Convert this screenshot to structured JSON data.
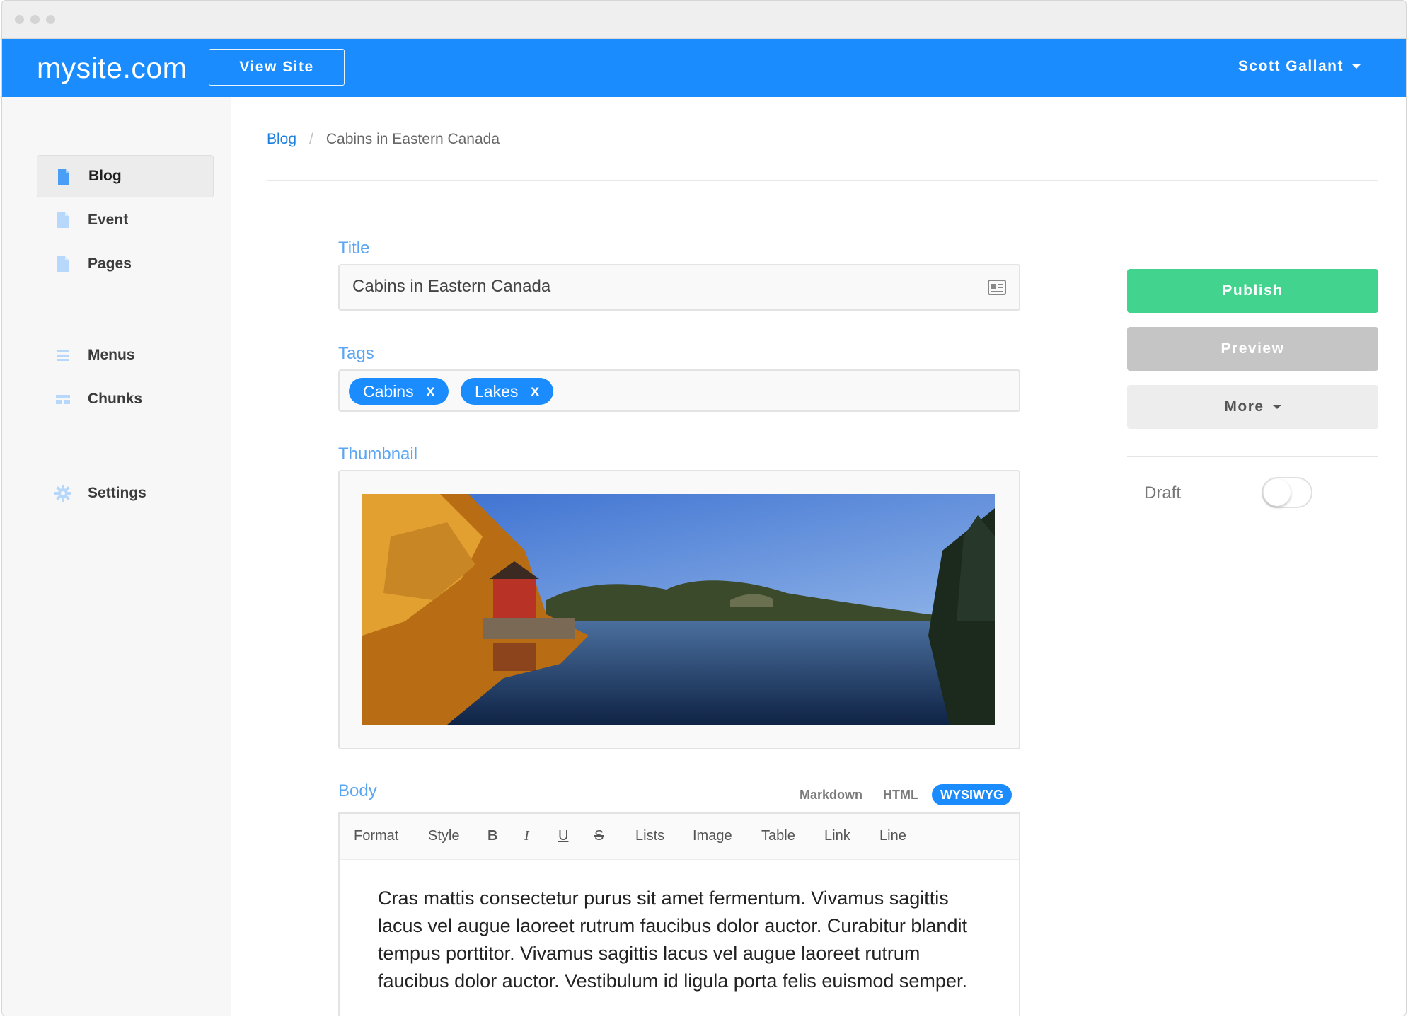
{
  "header": {
    "site_name": "mysite.com",
    "view_site_label": "View Site",
    "user_name": "Scott Gallant"
  },
  "sidebar": {
    "items": [
      {
        "label": "Blog",
        "icon": "document-icon",
        "active": true
      },
      {
        "label": "Event",
        "icon": "document-icon"
      },
      {
        "label": "Pages",
        "icon": "document-icon"
      },
      {
        "label": "Menus",
        "icon": "menu-lines-icon"
      },
      {
        "label": "Chunks",
        "icon": "chunks-icon"
      },
      {
        "label": "Settings",
        "icon": "gear-icon"
      }
    ]
  },
  "breadcrumb": {
    "parent": "Blog",
    "separator": "/",
    "current": "Cabins in Eastern Canada"
  },
  "form": {
    "title_label": "Title",
    "title_value": "Cabins in Eastern Canada",
    "tags_label": "Tags",
    "tags": [
      "Cabins",
      "Lakes"
    ],
    "tag_remove": "x",
    "thumbnail_label": "Thumbnail",
    "body_label": "Body",
    "body_modes": [
      "Markdown",
      "HTML",
      "WYSIWYG"
    ],
    "body_mode_selected": "WYSIWYG",
    "toolbar": [
      "Format",
      "Style",
      "B",
      "I",
      "U",
      "S",
      "Lists",
      "Image",
      "Table",
      "Link",
      "Line"
    ],
    "body_text": "Cras mattis consectetur purus sit amet fermentum. Vivamus sagittis lacus vel augue laoreet rutrum faucibus dolor auctor. Curabitur blandit tempus porttitor. Vivamus sagittis lacus vel augue laoreet rutrum faucibus dolor auctor. Vestibulum id ligula porta felis euismod semper."
  },
  "actions": {
    "publish": "Publish",
    "preview": "Preview",
    "more": "More",
    "draft_label": "Draft",
    "draft_on": false
  },
  "colors": {
    "brand": "#1a8cfe",
    "publish": "#42d48e",
    "label": "#5aa6f2"
  }
}
